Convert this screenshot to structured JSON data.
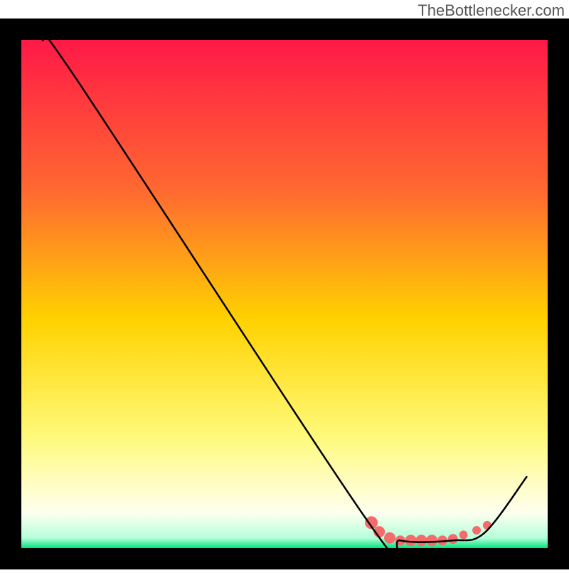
{
  "watermark": "TheBottlenecker.com",
  "chart_data": {
    "type": "line",
    "title": "",
    "xlabel": "",
    "ylabel": "",
    "xlim": [
      0,
      100
    ],
    "ylim": [
      0,
      100
    ],
    "border_thickness_px": 30,
    "gradient_stops": [
      {
        "pct": 0,
        "color": "#ff1947"
      },
      {
        "pct": 30,
        "color": "#ff6a30"
      },
      {
        "pct": 55,
        "color": "#ffd200"
      },
      {
        "pct": 78,
        "color": "#fffa7a"
      },
      {
        "pct": 93,
        "color": "#ffffef"
      },
      {
        "pct": 98,
        "color": "#b6ffdb"
      },
      {
        "pct": 100,
        "color": "#00e47a"
      }
    ],
    "curve": [
      {
        "x": 4,
        "y": 100
      },
      {
        "x": 10,
        "y": 93
      },
      {
        "x": 66,
        "y": 5
      },
      {
        "x": 72,
        "y": 1.5
      },
      {
        "x": 82,
        "y": 1.5
      },
      {
        "x": 88,
        "y": 3
      },
      {
        "x": 96,
        "y": 14
      }
    ],
    "markers": [
      {
        "x": 66.5,
        "y": 5.0,
        "r": 9
      },
      {
        "x": 68.0,
        "y": 3.2,
        "r": 8
      },
      {
        "x": 70.0,
        "y": 2.0,
        "r": 8
      },
      {
        "x": 72.0,
        "y": 1.5,
        "r": 7
      },
      {
        "x": 74.0,
        "y": 1.5,
        "r": 8
      },
      {
        "x": 76.0,
        "y": 1.5,
        "r": 8
      },
      {
        "x": 78.0,
        "y": 1.5,
        "r": 8
      },
      {
        "x": 80.0,
        "y": 1.5,
        "r": 7
      },
      {
        "x": 82.0,
        "y": 1.8,
        "r": 7
      },
      {
        "x": 84.0,
        "y": 2.6,
        "r": 6
      },
      {
        "x": 86.5,
        "y": 3.5,
        "r": 6
      },
      {
        "x": 88.5,
        "y": 4.5,
        "r": 6
      }
    ],
    "marker_color": "#f36b6b",
    "line_color": "#000000"
  }
}
